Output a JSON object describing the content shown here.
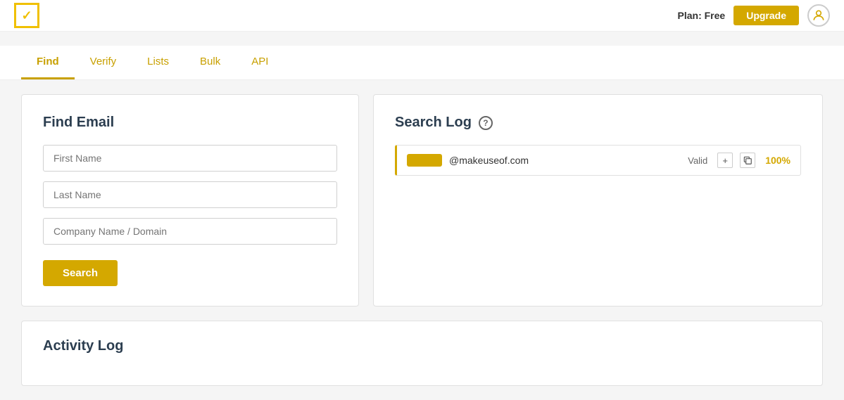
{
  "header": {
    "logo_alt": "Hunter Logo",
    "plan_label": "Plan:",
    "plan_type": "Free",
    "upgrade_label": "Upgrade"
  },
  "nav": {
    "tabs": [
      {
        "label": "Find",
        "active": true
      },
      {
        "label": "Verify",
        "active": false
      },
      {
        "label": "Lists",
        "active": false
      },
      {
        "label": "Bulk",
        "active": false
      },
      {
        "label": "API",
        "active": false
      }
    ]
  },
  "find_email": {
    "title": "Find Email",
    "first_name_placeholder": "First Name",
    "last_name_placeholder": "Last Name",
    "company_placeholder": "Company Name / Domain",
    "search_label": "Search"
  },
  "search_log": {
    "title": "Search Log",
    "help_tooltip": "Help",
    "entry": {
      "email_domain": "@makeuseof.com",
      "valid_label": "Valid",
      "percent": "100%",
      "add_icon": "+",
      "copy_icon": "⧉"
    }
  },
  "activity_log": {
    "title": "Activity Log"
  }
}
